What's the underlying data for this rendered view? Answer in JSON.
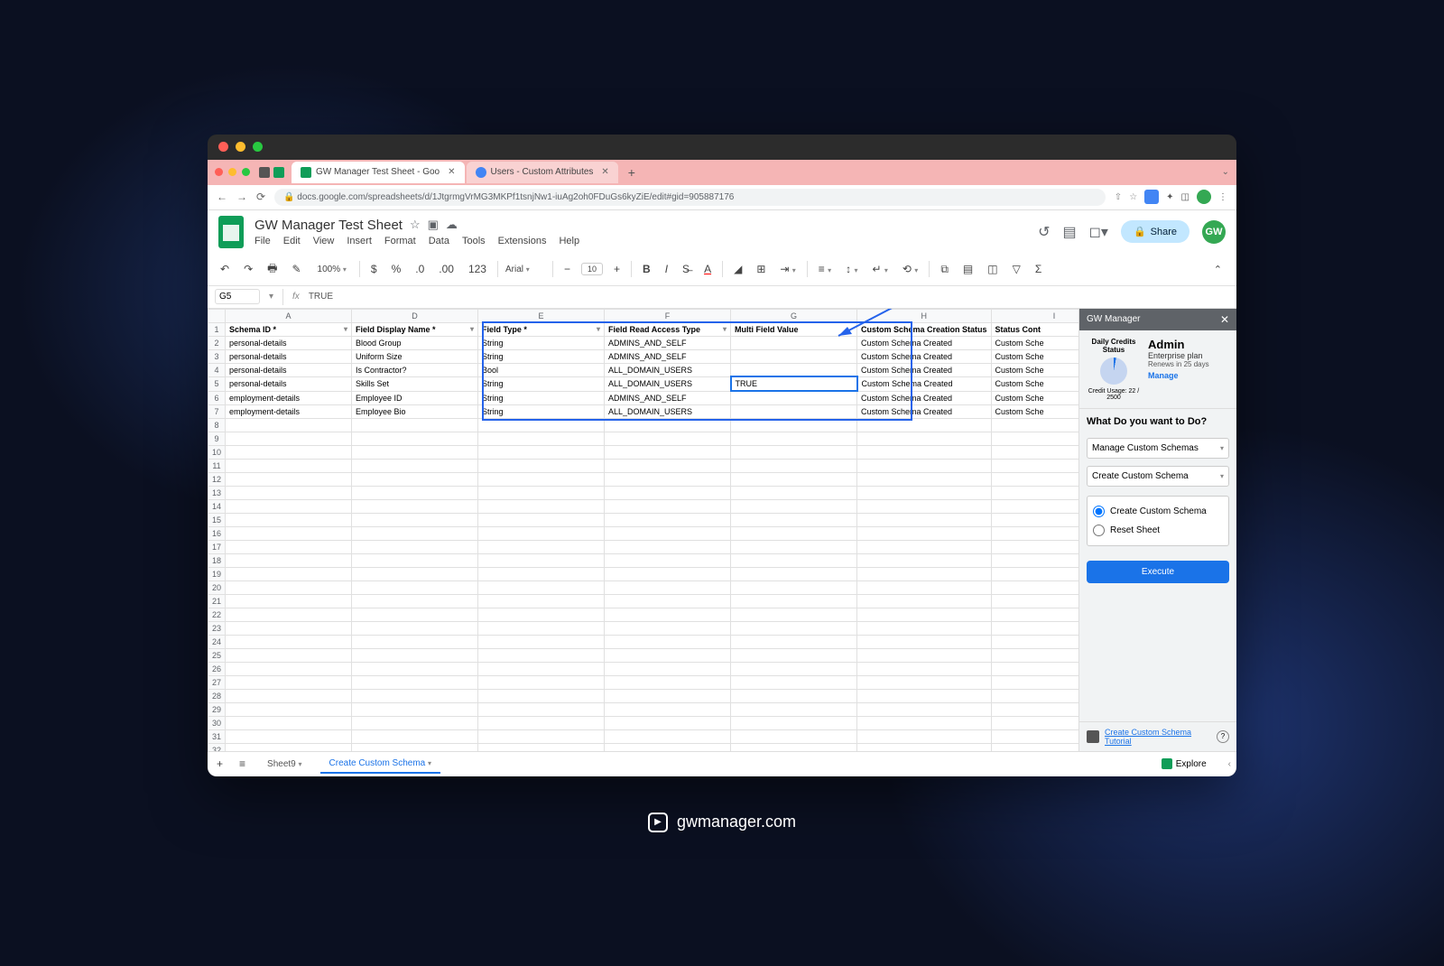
{
  "browser": {
    "tabs": [
      {
        "title": "GW Manager Test Sheet - Goo",
        "active": true
      },
      {
        "title": "Users - Custom Attributes",
        "active": false
      }
    ],
    "url": "docs.google.com/spreadsheets/d/1JtgrmgVrMG3MKPf1tsnjNw1-iuAg2oh0FDuGs6kyZiE/edit#gid=905887176"
  },
  "doc": {
    "title": "GW Manager Test Sheet",
    "menus": [
      "File",
      "Edit",
      "View",
      "Insert",
      "Format",
      "Data",
      "Tools",
      "Extensions",
      "Help"
    ],
    "share_label": "Share",
    "avatar": "GW"
  },
  "toolbar": {
    "zoom": "100%",
    "font": "Arial",
    "size": "10"
  },
  "formula": {
    "cell": "G5",
    "fx": "fx",
    "value": "TRUE"
  },
  "columns": [
    "A",
    "D",
    "E",
    "F",
    "G",
    "H",
    "I"
  ],
  "headers": [
    "Schema ID *",
    "Field Display Name *",
    "Field Type *",
    "Field Read Access Type",
    "Multi Field Value",
    "Custom Schema Creation Status",
    "Status Cont"
  ],
  "rows": [
    {
      "n": 2,
      "a": "personal-details",
      "d": "Blood Group",
      "e": "String",
      "f": "ADMINS_AND_SELF",
      "g": "",
      "h": "Custom Schema Created",
      "i": "Custom Sche"
    },
    {
      "n": 3,
      "a": "personal-details",
      "d": "Uniform Size",
      "e": "String",
      "f": "ADMINS_AND_SELF",
      "g": "",
      "h": "Custom Schema Created",
      "i": "Custom Sche"
    },
    {
      "n": 4,
      "a": "personal-details",
      "d": "Is Contractor?",
      "e": "Bool",
      "f": "ALL_DOMAIN_USERS",
      "g": "",
      "h": "Custom Schema Created",
      "i": "Custom Sche"
    },
    {
      "n": 5,
      "a": "personal-details",
      "d": "Skills Set",
      "e": "String",
      "f": "ALL_DOMAIN_USERS",
      "g": "TRUE",
      "h": "Custom Schema Created",
      "i": "Custom Sche"
    },
    {
      "n": 6,
      "a": "employment-details",
      "d": "Employee ID",
      "e": "String",
      "f": "ADMINS_AND_SELF",
      "g": "",
      "h": "Custom Schema Created",
      "i": "Custom Sche"
    },
    {
      "n": 7,
      "a": "employment-details",
      "d": "Employee Bio",
      "e": "String",
      "f": "ALL_DOMAIN_USERS",
      "g": "",
      "h": "Custom Schema Created",
      "i": "Custom Sche"
    }
  ],
  "empty_row_count": 30,
  "sidebar": {
    "title": "GW Manager",
    "credits_label": "Daily Credits Status",
    "credits_usage": "Credit Usage: 22 / 2500",
    "user": "Admin",
    "plan": "Enterprise plan",
    "renew": "Renews in 25 days",
    "manage": "Manage",
    "question": "What Do you want to Do?",
    "select1": "Manage Custom Schemas",
    "select2": "Create Custom Schema",
    "radio1": "Create Custom Schema",
    "radio2": "Reset Sheet",
    "execute": "Execute",
    "tutorial": "Create Custom Schema Tutorial"
  },
  "bottom": {
    "sheet1": "Sheet9",
    "sheet2": "Create Custom Schema",
    "explore": "Explore"
  },
  "brand": "gwmanager.com"
}
